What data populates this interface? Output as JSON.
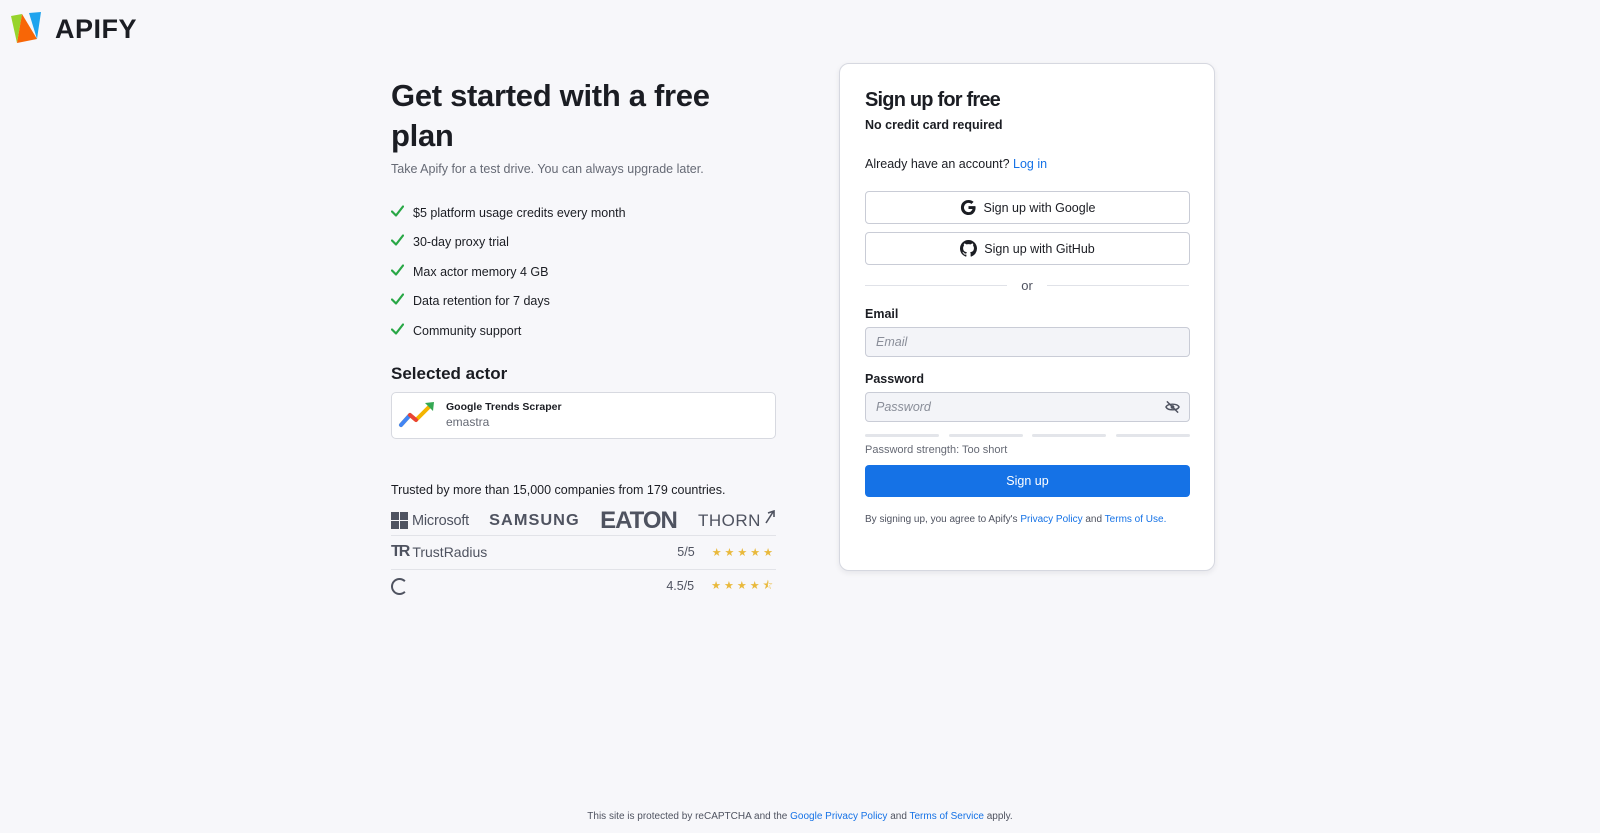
{
  "brand": {
    "name": "APIFY",
    "logo_icon": "apify-logo-icon"
  },
  "hero": {
    "title": "Get started with a free plan",
    "subtitle": "Take Apify for a test drive. You can always upgrade later.",
    "features": [
      "$5 platform usage credits every month",
      "30-day proxy trial",
      "Max actor memory 4 GB",
      "Data retention for 7 days",
      "Community support"
    ],
    "check_color": "#28a745"
  },
  "selected_actor": {
    "heading": "Selected actor",
    "name": "Google Trends Scraper",
    "author": "emastra"
  },
  "trust": {
    "text": "Trusted by more than 15,000 companies from 179 countries.",
    "companies": [
      "Microsoft",
      "SAMSUNG",
      "EATON",
      "THORN"
    ],
    "ratings": [
      {
        "brand": "TrustRadius",
        "score": "5/5",
        "stars": "★★★★★"
      },
      {
        "brand": "",
        "score": "4.5/5",
        "stars": "★★★★⯪"
      }
    ]
  },
  "signup": {
    "title": "Sign up for free",
    "subtitle": "No credit card required",
    "have_account": "Already have an account?",
    "login_link": "Log in",
    "google_button": "Sign up with Google",
    "github_button": "Sign up with GitHub",
    "or": "or",
    "email_label": "Email",
    "email_placeholder": "Email",
    "password_label": "Password",
    "password_placeholder": "Password",
    "strength": "Password strength: Too short",
    "submit": "Sign up",
    "terms_prefix": "By signing up, you agree to Apify's",
    "privacy_link": "Privacy Policy",
    "terms_and": "and",
    "terms_link": "Terms of Use.",
    "accent_color": "#1572e6"
  },
  "footer": {
    "prefix": "This site is protected by reCAPTCHA and the",
    "privacy_link": "Google Privacy Policy",
    "and": "and",
    "terms_link": "Terms of Service",
    "suffix": "apply."
  }
}
